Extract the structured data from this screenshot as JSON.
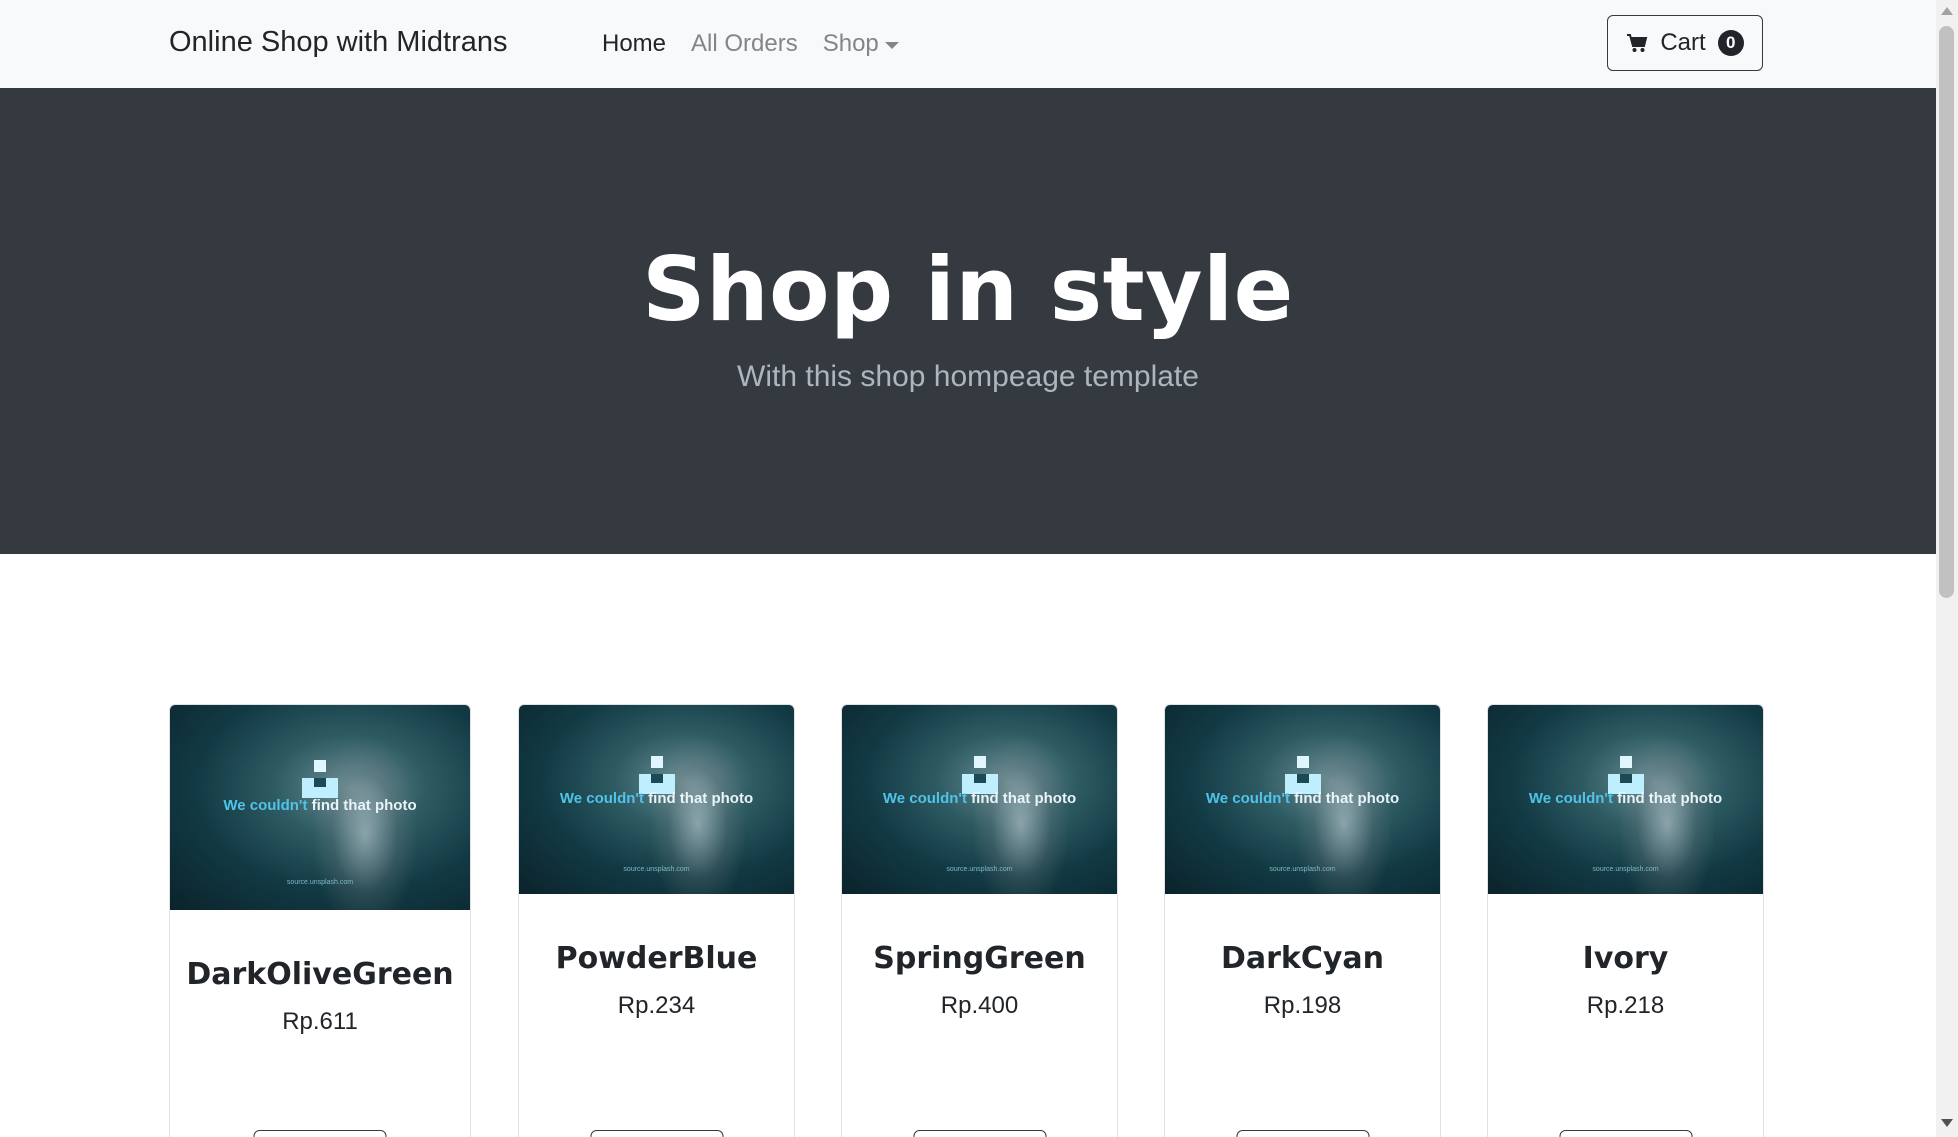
{
  "navbar": {
    "brand": "Online Shop with Midtrans",
    "links": [
      {
        "label": "Home",
        "active": true
      },
      {
        "label": "All Orders",
        "active": false
      },
      {
        "label": "Shop",
        "active": false,
        "dropdown": true
      }
    ],
    "cart": {
      "label": "Cart",
      "count": "0",
      "icon": "cart-icon"
    }
  },
  "hero": {
    "title": "Shop in style",
    "subtitle": "With this shop hompeage template",
    "background": "#343a40"
  },
  "placeholder_image": {
    "message_part1": "We couldn't ",
    "message_part2": "find that photo",
    "source": "source.unsplash.com"
  },
  "products": [
    {
      "name": "DarkOliveGreen",
      "price": "Rp.611"
    },
    {
      "name": "PowderBlue",
      "price": "Rp.234"
    },
    {
      "name": "SpringGreen",
      "price": "Rp.400"
    },
    {
      "name": "DarkCyan",
      "price": "Rp.198"
    },
    {
      "name": "Ivory",
      "price": "Rp.218"
    }
  ],
  "colors": {
    "navbar_bg": "#f8f9fa",
    "hero_bg": "#343a40",
    "text": "#212529",
    "muted_link": "#858585"
  }
}
